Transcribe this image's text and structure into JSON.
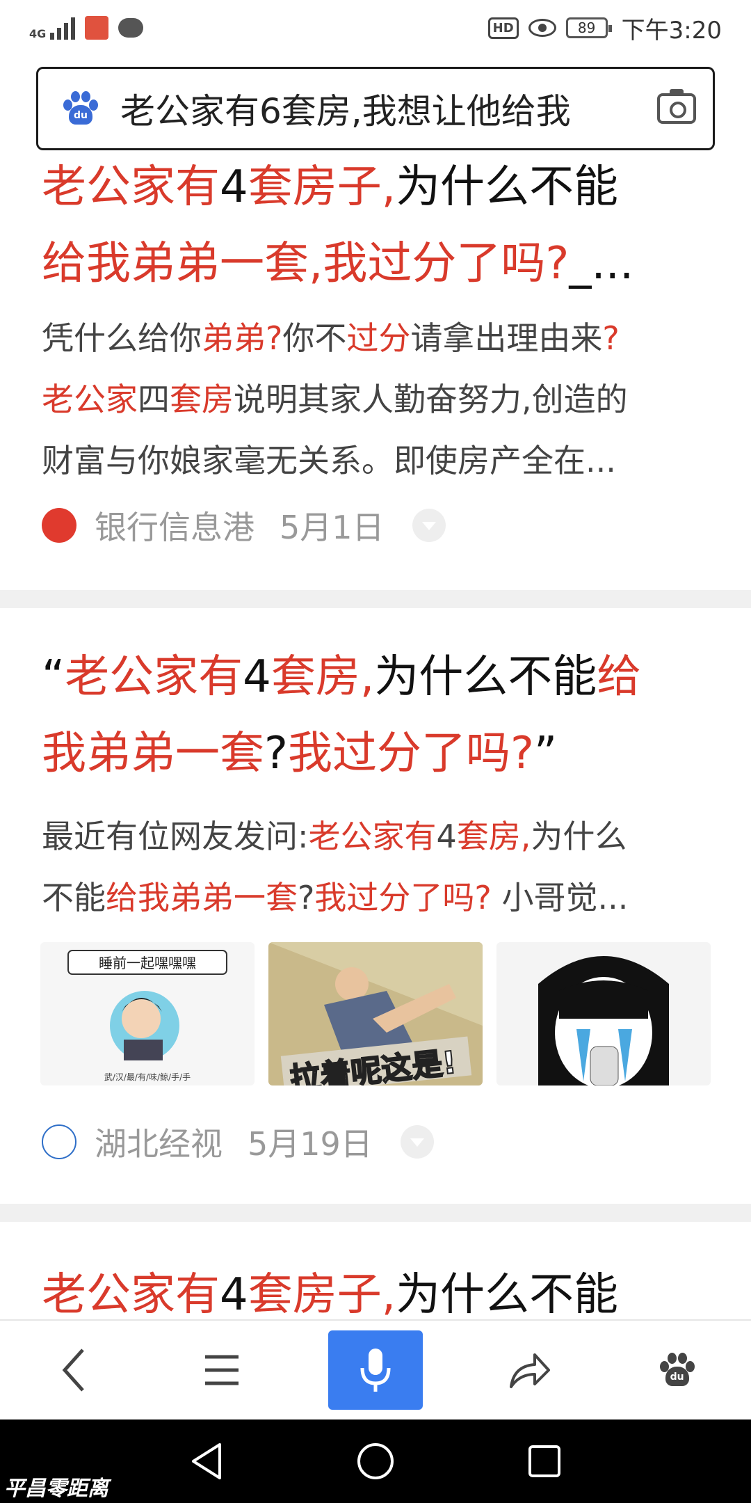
{
  "status_bar": {
    "network": "4G",
    "hd": "HD",
    "battery": "89",
    "time": "下午3:20"
  },
  "search": {
    "query": "老公家有6套房,我想让他给我",
    "logo_text": "du"
  },
  "results": [
    {
      "title_parts": [
        {
          "text": "老公家有",
          "hl": true
        },
        {
          "text": "4",
          "hl": false
        },
        {
          "text": "套房子,",
          "hl": true
        },
        {
          "text": "为什么不能",
          "hl": false
        }
      ],
      "title_line2_parts": [
        {
          "text": "给我弟弟一套,我过分了吗?",
          "hl": true
        },
        {
          "text": "_...",
          "hl": false
        }
      ],
      "snippet_lines": [
        [
          {
            "text": "凭什么给你",
            "hl": false
          },
          {
            "text": "弟弟?",
            "hl": true
          },
          {
            "text": "你不",
            "hl": false
          },
          {
            "text": "过分",
            "hl": true
          },
          {
            "text": "请拿出理由来",
            "hl": false
          },
          {
            "text": "?",
            "hl": true
          }
        ],
        [
          {
            "text": "老公家",
            "hl": true
          },
          {
            "text": "四",
            "hl": false
          },
          {
            "text": "套房",
            "hl": true
          },
          {
            "text": "说明其家人勤奋努力,创造的",
            "hl": false
          }
        ],
        [
          {
            "text": "财富与你娘家毫无关系。即使房产全在...",
            "hl": false
          }
        ]
      ],
      "source_name": "银行信息港",
      "date": "5月1日"
    },
    {
      "title_parts": [
        {
          "text": "“",
          "hl": false
        },
        {
          "text": "老公家有",
          "hl": true
        },
        {
          "text": "4",
          "hl": false
        },
        {
          "text": "套房,",
          "hl": true
        },
        {
          "text": "为什么不能",
          "hl": false
        },
        {
          "text": "给",
          "hl": true
        }
      ],
      "title_line2_parts": [
        {
          "text": "我弟弟一套",
          "hl": true
        },
        {
          "text": "?",
          "hl": false
        },
        {
          "text": "我过分了吗?",
          "hl": true
        },
        {
          "text": "”",
          "hl": false
        }
      ],
      "snippet_lines": [
        [
          {
            "text": "最近有位网友发问:",
            "hl": false
          },
          {
            "text": "老公家有",
            "hl": true
          },
          {
            "text": "4",
            "hl": false
          },
          {
            "text": "套房,",
            "hl": true
          },
          {
            "text": "为什么",
            "hl": false
          }
        ],
        [
          {
            "text": "不能",
            "hl": false
          },
          {
            "text": "给我弟弟一套",
            "hl": true
          },
          {
            "text": "?",
            "hl": false
          },
          {
            "text": "我过分了吗?",
            "hl": true
          },
          {
            "text": " 小哥觉...",
            "hl": false
          }
        ]
      ],
      "thumb_captions": [
        "睡前一起嘿嘿嘿",
        "拉着呢这是!",
        ""
      ],
      "source_name": "湖北经视",
      "date": "5月19日"
    },
    {
      "title_parts": [
        {
          "text": "老公家有",
          "hl": true
        },
        {
          "text": "4",
          "hl": false
        },
        {
          "text": "套房子,",
          "hl": true
        },
        {
          "text": "为什么不能",
          "hl": false
        }
      ]
    }
  ],
  "watermark": "平昌零距离",
  "colors": {
    "highlight": "#d93a2b",
    "accent_blue": "#3a7df0",
    "divider": "#f0f0f0"
  },
  "icons": [
    "back-icon",
    "menu-icon",
    "mic-icon",
    "share-icon",
    "baidu-paw-icon",
    "nav-back-icon",
    "nav-home-icon",
    "nav-recents-icon"
  ]
}
